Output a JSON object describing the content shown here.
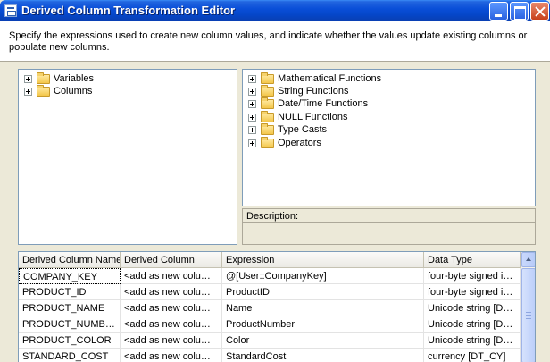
{
  "window": {
    "title": "Derived Column Transformation Editor"
  },
  "header": {
    "description": "Specify the expressions used to create new column values, and indicate whether the values update existing columns or populate new columns."
  },
  "left_tree": {
    "items": [
      {
        "label": "Variables",
        "icon": "folder-icon"
      },
      {
        "label": "Columns",
        "icon": "folder-icon"
      }
    ]
  },
  "right_tree": {
    "items": [
      {
        "label": "Mathematical Functions",
        "icon": "folder-icon"
      },
      {
        "label": "String Functions",
        "icon": "folder-icon"
      },
      {
        "label": "Date/Time Functions",
        "icon": "folder-icon"
      },
      {
        "label": "NULL Functions",
        "icon": "folder-icon"
      },
      {
        "label": "Type Casts",
        "icon": "folder-icon"
      },
      {
        "label": "Operators",
        "icon": "folder-icon"
      }
    ]
  },
  "description_panel": {
    "label": "Description:"
  },
  "grid": {
    "columns": [
      "Derived Column Name",
      "Derived Column",
      "Expression",
      "Data Type"
    ],
    "rows": [
      [
        "COMPANY_KEY",
        "<add as new column>",
        "@[User::CompanyKey]",
        "four-byte signed int..."
      ],
      [
        "PRODUCT_ID",
        "<add as new column>",
        "ProductID",
        "four-byte signed int..."
      ],
      [
        "PRODUCT_NAME",
        "<add as new column>",
        "Name",
        "Unicode string [DT_..."
      ],
      [
        "PRODUCT_NUMBER",
        "<add as new column>",
        "ProductNumber",
        "Unicode string [DT_..."
      ],
      [
        "PRODUCT_COLOR",
        "<add as new column>",
        "Color",
        "Unicode string [DT_..."
      ],
      [
        "STANDARD_COST",
        "<add as new column>",
        "StandardCost",
        "currency [DT_CY]"
      ]
    ]
  },
  "colors": {
    "title_bar": "#0a4fd8",
    "dialog_bg": "#ece9d8",
    "pane_border": "#7f9db9"
  }
}
